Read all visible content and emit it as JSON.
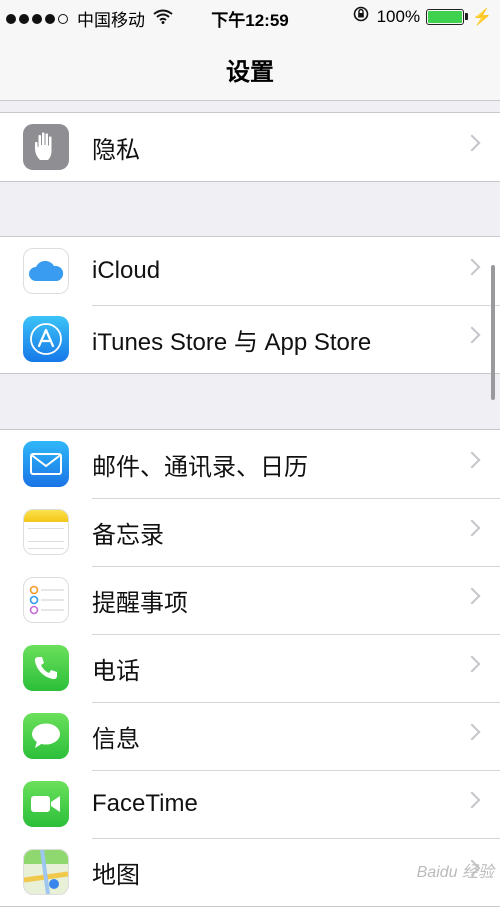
{
  "status_bar": {
    "carrier": "中国移动",
    "time": "下午12:59",
    "battery": "100%",
    "battery_level": 1.0
  },
  "navbar": {
    "title": "设置"
  },
  "groups": [
    {
      "items": [
        {
          "label": "隐私",
          "icon": "privacy-hand-icon"
        }
      ]
    },
    {
      "items": [
        {
          "label": "iCloud",
          "icon": "icloud-icon"
        },
        {
          "label": "iTunes Store 与 App Store",
          "icon": "app-store-icon"
        }
      ]
    },
    {
      "items": [
        {
          "label": "邮件、通讯录、日历",
          "icon": "mail-icon"
        },
        {
          "label": "备忘录",
          "icon": "notes-icon"
        },
        {
          "label": "提醒事项",
          "icon": "reminders-icon"
        },
        {
          "label": "电话",
          "icon": "phone-icon"
        },
        {
          "label": "信息",
          "icon": "messages-icon"
        },
        {
          "label": "FaceTime",
          "icon": "facetime-icon"
        },
        {
          "label": "地图",
          "icon": "maps-icon"
        }
      ]
    }
  ],
  "colors": {
    "background": "#efeff4",
    "battery_fill": "#3ed14e",
    "chevron": "#c4c4c9"
  },
  "watermark": "Baidu 经验"
}
